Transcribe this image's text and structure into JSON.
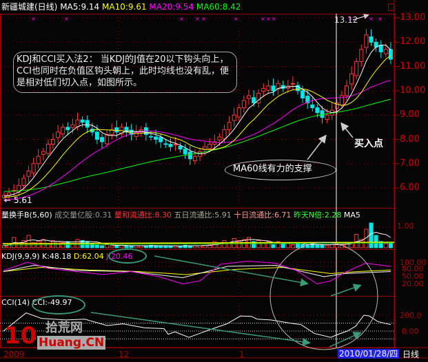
{
  "header": {
    "stock": "新疆城建(日线)",
    "ma5": "MA5:9.14",
    "ma10": "MA10:9.61",
    "ma20": "MA20:9.54",
    "ma60": "MA60:8.42"
  },
  "price_axis": [
    "13.00",
    "12.00",
    "11.00",
    "10.00",
    "9.00",
    "8.00",
    "7.00",
    "6.00"
  ],
  "annotations": {
    "high": "13.12",
    "low": "← 5.61",
    "buy_point": "买入点",
    "ma60_support": "MA60线有力的支撑",
    "callout": "KDJ和CCI买入法2：  当KDJ的J值在20以下钩头向上，CCI也同时在负值区钩头朝上，此时均线也没有乱，便是相对低们切入点，如图所示。"
  },
  "volume_panel": {
    "name": "量换手B(5,60)",
    "vol": "成交量亿股:0.31",
    "ratio": "量和流通比:8.30",
    "five": "五日流通比:5.91",
    "ten": "十日流通比:6.71",
    "nbei": "昨天N倍:2.28",
    "ma5": "MA5",
    "axis": "1.00"
  },
  "kdj_panel": {
    "name": "KDJ(9,9,9)",
    "k": "K:48.18",
    "d": "D:62.04",
    "j": "J:20.46",
    "axis": [
      "100.00",
      "80.00",
      "50.00",
      "20.00"
    ]
  },
  "cci_panel": {
    "name": "CCI(14)",
    "cci": "CCI:-49.97",
    "axis": [
      "200.0",
      "0.00"
    ]
  },
  "date_axis": {
    "labels": [
      "2009",
      "12",
      "1"
    ],
    "cursor_date": "2010/01/28/四",
    "period": "日线"
  },
  "logo": {
    "num": "10",
    "cn": "拾荒网",
    "en": "Huang.CN"
  },
  "colors": {
    "up": "#ff3b3b",
    "down": "#00e5e5",
    "ma5": "#ffffff",
    "ma10": "#ffff00",
    "ma20": "#ff00ff",
    "ma60": "#00ff00",
    "axis": "#a00000"
  },
  "chart_data": {
    "type": "candlestick",
    "closes": [
      5.7,
      5.8,
      5.9,
      6.1,
      6.4,
      6.7,
      7.0,
      7.3,
      7.5,
      7.8,
      8.0,
      8.3,
      8.5,
      8.4,
      8.6,
      8.8,
      8.7,
      8.5,
      8.3,
      8.0,
      7.9,
      8.2,
      8.4,
      8.3,
      8.5,
      8.3,
      8.2,
      8.3,
      8.4,
      8.2,
      8.1,
      8.0,
      7.9,
      7.8,
      7.7,
      7.8,
      7.6,
      7.4,
      7.2,
      7.3,
      7.5,
      7.7,
      7.8,
      7.9,
      8.1,
      8.4,
      8.7,
      9.0,
      9.3,
      9.6,
      9.8,
      9.5,
      9.9,
      10.1,
      10.2,
      10.0,
      10.3,
      10.1,
      10.2,
      10.3,
      10.0,
      9.7,
      9.5,
      9.3,
      9.1,
      8.9,
      9.0,
      9.2,
      9.5,
      9.8,
      10.2,
      10.7,
      11.2,
      11.7,
      12.3,
      12.0,
      11.8,
      11.6,
      11.7,
      11.3
    ],
    "volumes": [
      0.1,
      0.15,
      0.5,
      0.2,
      0.35,
      0.6,
      0.25,
      0.3,
      0.4,
      0.2,
      0.35,
      0.3,
      0.25,
      0.3,
      0.2,
      0.4,
      0.35,
      0.3,
      0.2,
      0.15,
      0.1,
      0.15,
      0.1,
      0.1,
      0.12,
      0.1,
      0.08,
      0.1,
      0.1,
      0.1,
      0.12,
      0.1,
      0.08,
      0.1,
      0.08,
      0.1,
      0.08,
      0.12,
      0.1,
      0.1,
      0.1,
      0.12,
      0.15,
      0.3,
      0.2,
      0.35,
      0.25,
      0.45,
      0.35,
      0.4,
      0.5,
      0.3,
      0.35,
      0.2,
      0.3,
      0.15,
      0.3,
      0.25,
      0.2,
      0.15,
      0.2,
      0.15,
      0.12,
      0.2,
      0.15,
      0.15,
      0.1,
      0.15,
      0.2,
      0.2,
      0.2,
      0.25,
      0.65,
      0.4,
      0.9,
      1.2,
      0.6,
      0.3,
      0.2,
      0.2
    ],
    "cci": [
      [
        5,
        0
      ],
      [
        38,
        230
      ],
      [
        60,
        160
      ],
      [
        95,
        140
      ],
      [
        123,
        150
      ],
      [
        155,
        70
      ],
      [
        179,
        90
      ],
      [
        210,
        40
      ],
      [
        238,
        30
      ],
      [
        244,
        -40
      ],
      [
        254,
        -10
      ],
      [
        274,
        -80
      ],
      [
        290,
        -30
      ],
      [
        302,
        10
      ],
      [
        329,
        90
      ],
      [
        349,
        190
      ],
      [
        365,
        185
      ],
      [
        373,
        150
      ],
      [
        393,
        140
      ],
      [
        421,
        100
      ],
      [
        437,
        80
      ],
      [
        456,
        -30
      ],
      [
        480,
        -80
      ],
      [
        488,
        -50
      ],
      [
        504,
        0
      ],
      [
        516,
        60
      ],
      [
        528,
        200
      ],
      [
        536,
        190
      ],
      [
        548,
        120
      ],
      [
        567,
        80
      ]
    ],
    "kdj_j": [
      [
        5,
        60
      ],
      [
        40,
        100
      ],
      [
        70,
        70
      ],
      [
        110,
        55
      ],
      [
        150,
        40
      ],
      [
        190,
        55
      ],
      [
        230,
        30
      ],
      [
        265,
        -5
      ],
      [
        290,
        10
      ],
      [
        320,
        90
      ],
      [
        360,
        105
      ],
      [
        400,
        95
      ],
      [
        430,
        60
      ],
      [
        460,
        -5
      ],
      [
        480,
        10
      ],
      [
        500,
        50
      ],
      [
        530,
        95
      ],
      [
        567,
        80
      ]
    ],
    "kdj_k": [
      [
        5,
        55
      ],
      [
        50,
        85
      ],
      [
        110,
        60
      ],
      [
        190,
        55
      ],
      [
        265,
        25
      ],
      [
        330,
        80
      ],
      [
        400,
        85
      ],
      [
        470,
        30
      ],
      [
        500,
        45
      ],
      [
        567,
        55
      ]
    ],
    "kdj_d": [
      [
        5,
        55
      ],
      [
        60,
        75
      ],
      [
        130,
        62
      ],
      [
        200,
        55
      ],
      [
        270,
        40
      ],
      [
        340,
        65
      ],
      [
        410,
        75
      ],
      [
        480,
        45
      ],
      [
        520,
        55
      ],
      [
        567,
        62
      ]
    ]
  }
}
